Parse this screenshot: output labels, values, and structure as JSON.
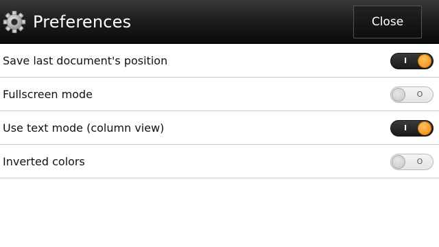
{
  "header": {
    "title": "Preferences",
    "close_label": "Close",
    "icon": "gear-icon"
  },
  "settings": [
    {
      "label": "Save last document's position",
      "enabled": true,
      "on_mark": "I",
      "off_mark": "O"
    },
    {
      "label": "Fullscreen mode",
      "enabled": false,
      "on_mark": "I",
      "off_mark": "O"
    },
    {
      "label": "Use text mode (column view)",
      "enabled": true,
      "on_mark": "I",
      "off_mark": "O"
    },
    {
      "label": "Inverted colors",
      "enabled": false,
      "on_mark": "I",
      "off_mark": "O"
    }
  ],
  "colors": {
    "accent": "#f49a20",
    "header_bg": "#1e1e1e",
    "divider": "#c8c8c8"
  }
}
